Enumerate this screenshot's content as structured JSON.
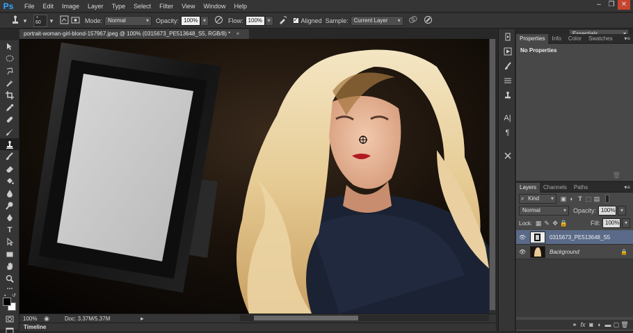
{
  "app": {
    "logo": "Ps"
  },
  "menubar": {
    "items": [
      "File",
      "Edit",
      "Image",
      "Layer",
      "Type",
      "Select",
      "Filter",
      "View",
      "Window",
      "Help"
    ]
  },
  "window_controls": {
    "minimize": "–",
    "maximize": "❐",
    "close": "✕"
  },
  "options": {
    "brush_size": "60",
    "mode_label": "Mode:",
    "mode_value": "Normal",
    "opacity_label": "Opacity:",
    "opacity_value": "100%",
    "flow_label": "Flow:",
    "flow_value": "100%",
    "aligned_label": "Aligned",
    "sample_label": "Sample:",
    "sample_value": "Current Layer",
    "workspace": "Essentials"
  },
  "document": {
    "tab_title": "portrait-woman-girl-blond-157967.jpeg @ 100% (0315673_PE513648_S5, RGB/8) *",
    "tab_close": "×",
    "zoom": "100%",
    "doc_size": "Doc: 3.37M/5.37M"
  },
  "timeline": {
    "label": "Timeline"
  },
  "properties_panel": {
    "tabs": [
      "Properties",
      "Info",
      "Color",
      "Swatches"
    ],
    "content": "No Properties"
  },
  "layers_panel": {
    "tabs": [
      "Layers",
      "Channels",
      "Paths"
    ],
    "filter_kind": "Kind",
    "blend_mode": "Normal",
    "opacity_label": "Opacity:",
    "opacity_value": "100%",
    "lock_label": "Lock:",
    "fill_label": "Fill:",
    "fill_value": "100%",
    "layers": [
      {
        "name": "0315673_PE513648_S5",
        "selected": true
      },
      {
        "name": "Background",
        "selected": false
      }
    ]
  },
  "colors": {
    "accent": "#31a8ff",
    "layer_selected": "#5a6a88",
    "panel": "#484848",
    "chrome": "#353535"
  }
}
